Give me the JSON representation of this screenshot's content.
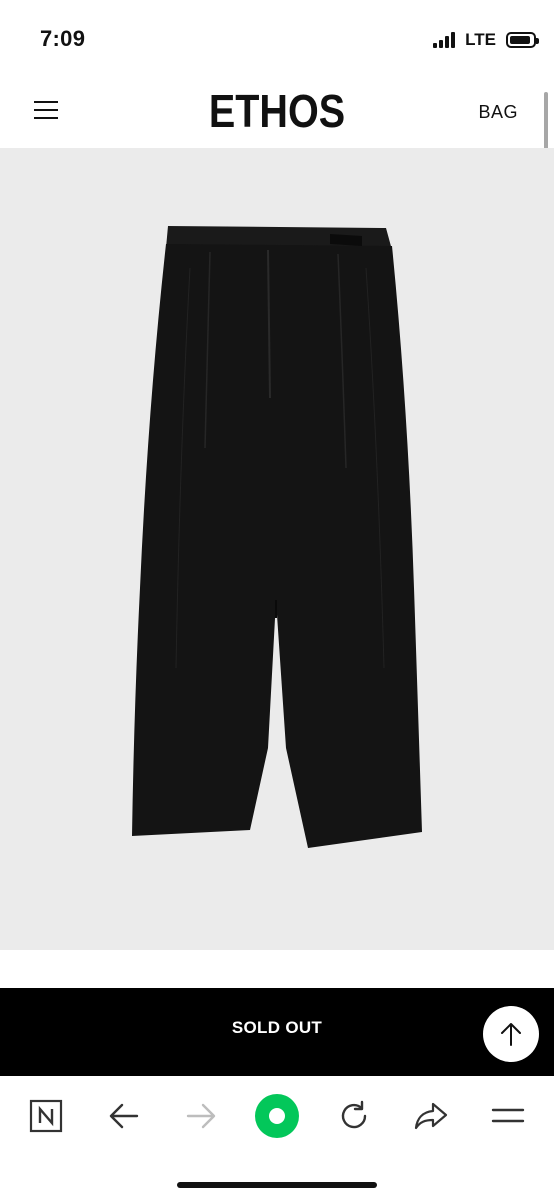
{
  "status_bar": {
    "time": "7:09",
    "network": "LTE"
  },
  "header": {
    "brand": "ETHOS",
    "bag_label": "BAG",
    "menu_icon": "hamburger-menu-icon"
  },
  "product": {
    "image_background": "#ebebeb",
    "image_icon": "black-trousers-image"
  },
  "purchase_bar": {
    "status_label": "SOLD OUT",
    "background": "#000000",
    "scroll_top_icon": "arrow-up-icon"
  },
  "browser_toolbar": {
    "items": [
      {
        "icon": "naver-home-icon"
      },
      {
        "icon": "back-arrow-icon"
      },
      {
        "icon": "forward-arrow-icon"
      },
      {
        "icon": "green-circle-icon"
      },
      {
        "icon": "reload-icon"
      },
      {
        "icon": "share-icon"
      },
      {
        "icon": "menu-icon"
      }
    ],
    "accent": "#03c75a"
  }
}
